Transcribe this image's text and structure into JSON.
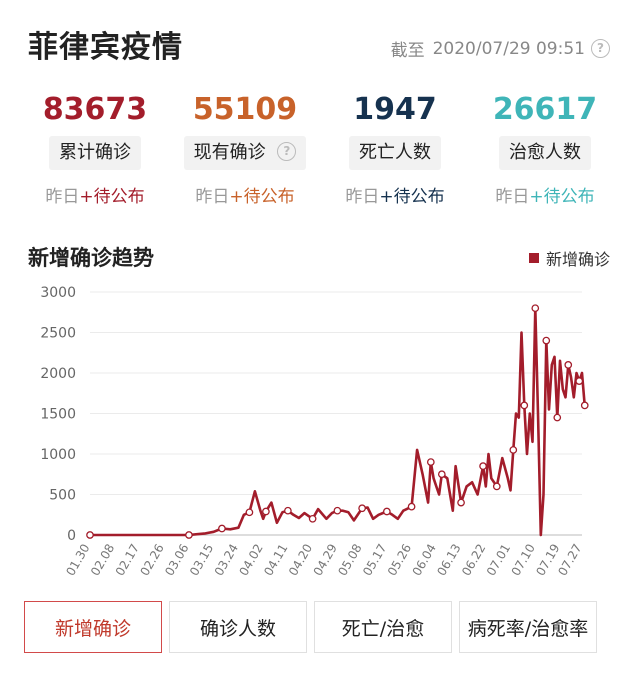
{
  "header": {
    "title": "菲律宾疫情",
    "as_of_label": "截至",
    "as_of_time": "2020/07/29 09:51"
  },
  "stats": [
    {
      "value": "83673",
      "label": "累计确诊",
      "delta_prefix": "昨日",
      "delta": "+待公布",
      "color": "#a31d2b",
      "has_help": false
    },
    {
      "value": "55109",
      "label": "现有确诊",
      "delta_prefix": "昨日",
      "delta": "+待公布",
      "color": "#c8622a",
      "has_help": true
    },
    {
      "value": "1947",
      "label": "死亡人数",
      "delta_prefix": "昨日",
      "delta": "+待公布",
      "color": "#16324f",
      "has_help": false
    },
    {
      "value": "26617",
      "label": "治愈人数",
      "delta_prefix": "昨日",
      "delta": "+待公布",
      "color": "#3fb5b8",
      "has_help": false
    }
  ],
  "trend": {
    "title": "新增确诊趋势",
    "legend": "新增确诊",
    "color": "#a31d2b"
  },
  "chart_data": {
    "type": "line",
    "title": "新增确诊趋势",
    "xlabel": "",
    "ylabel": "",
    "ylim": [
      0,
      3000
    ],
    "yticks": [
      0,
      500,
      1000,
      1500,
      2000,
      2500,
      3000
    ],
    "grid": true,
    "legend_position": "top-right",
    "x_tick_labels": [
      "01.30",
      "02.08",
      "02.17",
      "02.26",
      "03.06",
      "03.15",
      "03.24",
      "04.02",
      "04.11",
      "04.20",
      "04.29",
      "05.08",
      "05.17",
      "05.26",
      "06.04",
      "06.13",
      "06.22",
      "07.01",
      "07.10",
      "07.19",
      "07.27"
    ],
    "series": [
      {
        "name": "新增确诊",
        "color": "#a31d2b",
        "x": [
          "01.30",
          "02.08",
          "02.17",
          "02.26",
          "03.06",
          "03.09",
          "03.12",
          "03.15",
          "03.18",
          "03.21",
          "03.24",
          "03.26",
          "03.28",
          "03.30",
          "04.01",
          "04.02",
          "04.03",
          "04.05",
          "04.07",
          "04.09",
          "04.11",
          "04.13",
          "04.15",
          "04.17",
          "04.20",
          "04.22",
          "04.25",
          "04.27",
          "04.29",
          "05.01",
          "05.03",
          "05.05",
          "05.08",
          "05.10",
          "05.12",
          "05.14",
          "05.17",
          "05.19",
          "05.21",
          "05.23",
          "05.26",
          "05.28",
          "05.30",
          "06.01",
          "06.02",
          "06.03",
          "06.04",
          "06.05",
          "06.06",
          "06.08",
          "06.10",
          "06.11",
          "06.13",
          "06.15",
          "06.17",
          "06.19",
          "06.21",
          "06.22",
          "06.23",
          "06.24",
          "06.26",
          "06.28",
          "06.30",
          "07.01",
          "07.02",
          "07.03",
          "07.04",
          "07.05",
          "07.06",
          "07.07",
          "07.08",
          "07.09",
          "07.10",
          "07.11",
          "07.12",
          "07.13",
          "07.14",
          "07.15",
          "07.16",
          "07.17",
          "07.18",
          "07.19",
          "07.20",
          "07.21",
          "07.22",
          "07.23",
          "07.24",
          "07.25",
          "07.26",
          "07.27",
          "07.28"
        ],
        "values": [
          0,
          0,
          0,
          0,
          0,
          10,
          20,
          40,
          80,
          70,
          90,
          250,
          280,
          540,
          300,
          200,
          290,
          400,
          150,
          280,
          300,
          250,
          210,
          270,
          200,
          320,
          200,
          270,
          300,
          300,
          280,
          180,
          330,
          340,
          200,
          250,
          290,
          250,
          200,
          300,
          350,
          1050,
          750,
          400,
          900,
          700,
          600,
          500,
          750,
          700,
          300,
          850,
          400,
          600,
          650,
          500,
          850,
          600,
          1000,
          700,
          600,
          950,
          700,
          550,
          1050,
          1500,
          1450,
          2500,
          1600,
          1000,
          1500,
          1150,
          2800,
          1500,
          0,
          500,
          2400,
          1550,
          2100,
          2200,
          1450,
          2150,
          1800,
          1700,
          2100,
          1950,
          1700,
          2000,
          1900,
          2000,
          1600
        ]
      }
    ]
  },
  "tabs": [
    {
      "label": "新增确诊",
      "active": true
    },
    {
      "label": "确诊人数",
      "active": false
    },
    {
      "label": "死亡/治愈",
      "active": false
    },
    {
      "label": "病死率/治愈率",
      "active": false
    }
  ]
}
